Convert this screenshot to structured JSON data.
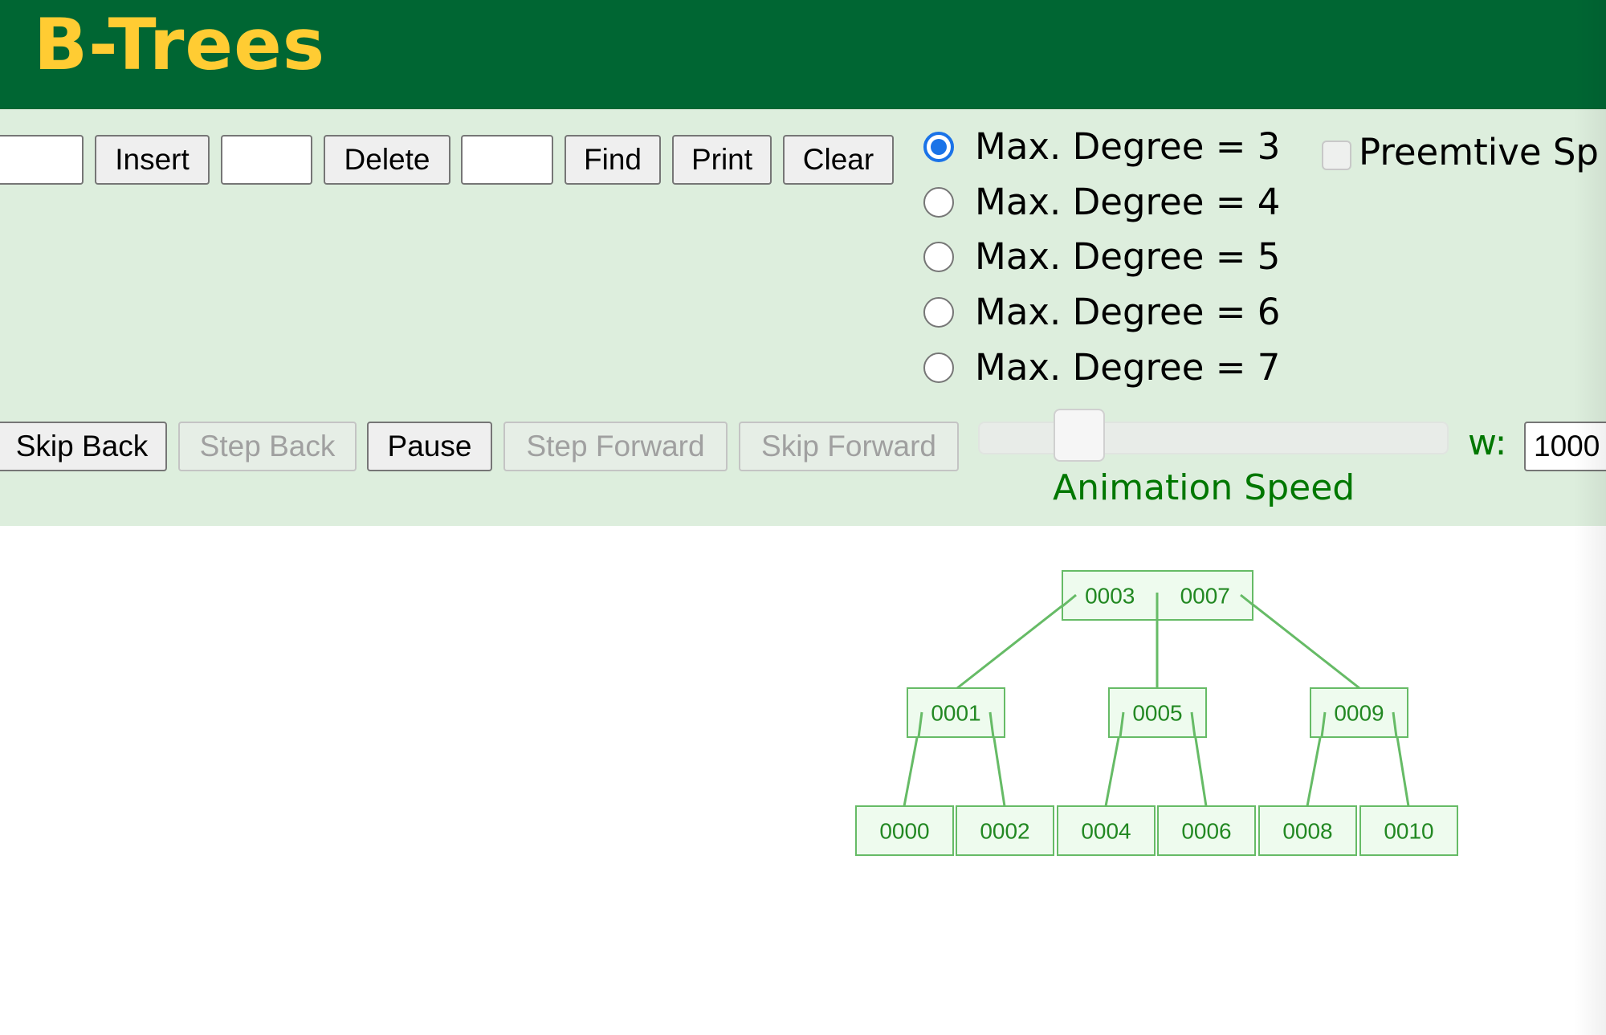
{
  "header": {
    "title": "B-Trees"
  },
  "controls": {
    "insert_input": "",
    "insert_label": "Insert",
    "delete_input": "",
    "delete_label": "Delete",
    "find_input": "",
    "find_label": "Find",
    "print_label": "Print",
    "clear_label": "Clear"
  },
  "degree_options": [
    {
      "label": "Max. Degree = 3",
      "selected": true
    },
    {
      "label": "Max. Degree = 4",
      "selected": false
    },
    {
      "label": "Max. Degree = 5",
      "selected": false
    },
    {
      "label": "Max. Degree = 6",
      "selected": false
    },
    {
      "label": "Max. Degree = 7",
      "selected": false
    }
  ],
  "preemptive": {
    "label": "Preemtive Sp",
    "checked": false
  },
  "animation": {
    "skip_back": "Skip Back",
    "step_back": "Step Back",
    "pause": "Pause",
    "step_forward": "Step Forward",
    "skip_forward": "Skip Forward",
    "speed_label": "Animation Speed",
    "speed_fraction": 0.17,
    "w_label": "w:",
    "w_value": "1000"
  },
  "tree": {
    "root": [
      "0003",
      "0007"
    ],
    "level1": [
      [
        "0001"
      ],
      [
        "0005"
      ],
      [
        "0009"
      ]
    ],
    "leaves": [
      [
        "0000"
      ],
      [
        "0002"
      ],
      [
        "0004"
      ],
      [
        "0006"
      ],
      [
        "0008"
      ],
      [
        "0010"
      ]
    ]
  },
  "colors": {
    "header": "#006633",
    "title": "#ffcc33",
    "panel": "#ddeedd",
    "node_stroke": "#66bb66",
    "node_fill": "#eefbee",
    "node_text": "#228822"
  }
}
